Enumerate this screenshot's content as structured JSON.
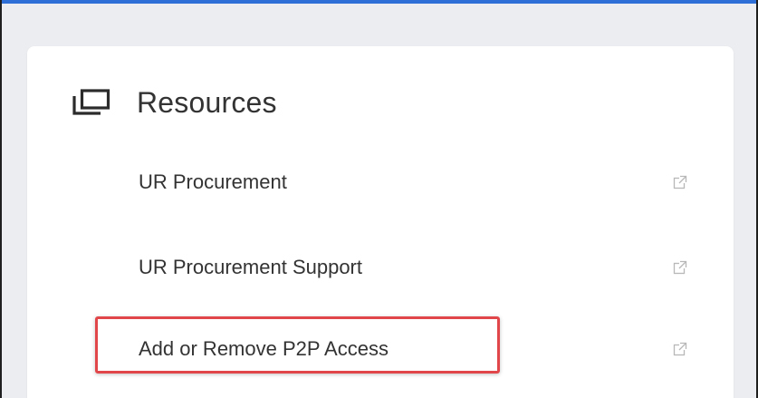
{
  "colors": {
    "top_strip": "#2d6fd6",
    "background": "#ebedf0",
    "card": "#ffffff",
    "text": "#333333",
    "icon_muted": "#b8b8b8",
    "highlight": "#e0464a"
  },
  "resources": {
    "title": "Resources",
    "header_icon": "stacked-windows-icon",
    "links": [
      {
        "label": "UR Procurement",
        "icon": "external-link-icon"
      },
      {
        "label": "UR Procurement Support",
        "icon": "external-link-icon"
      },
      {
        "label": "Add or Remove P2P Access",
        "icon": "external-link-icon",
        "highlighted": true
      }
    ]
  }
}
